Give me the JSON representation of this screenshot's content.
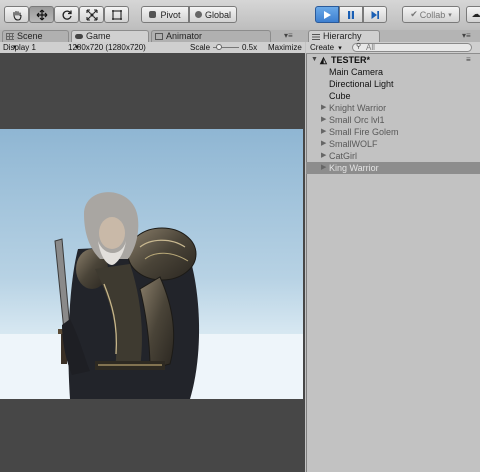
{
  "toolbar": {
    "tools": [
      {
        "name": "hand-tool-icon",
        "active": false
      },
      {
        "name": "move-tool-icon",
        "active": true
      },
      {
        "name": "rotate-tool-icon",
        "active": false
      },
      {
        "name": "scale-tool-icon",
        "active": false
      },
      {
        "name": "rect-tool-icon",
        "active": false
      }
    ],
    "pivot_label": "Pivot",
    "global_label": "Global",
    "collab_label": "Collab",
    "play_icon": "play-icon",
    "pause_icon": "pause-icon",
    "step_icon": "step-icon"
  },
  "tabs": {
    "scene": "Scene",
    "game": "Game",
    "animator": "Animator",
    "hierarchy": "Hierarchy"
  },
  "gamebar": {
    "display": "Display 1",
    "resolution": "1280x720 (1280x720)",
    "scale_label": "Scale",
    "scale_value": "0.5x",
    "maximize": "Maximize"
  },
  "hierarchy": {
    "create_label": "Create",
    "search_placeholder": "All",
    "scene_name": "TESTER*",
    "items": [
      {
        "label": "Main Camera",
        "expandable": false,
        "selected": false
      },
      {
        "label": "Directional Light",
        "expandable": false,
        "selected": false
      },
      {
        "label": "Cube",
        "expandable": false,
        "selected": false
      },
      {
        "label": "Knight Warrior",
        "expandable": true,
        "selected": false
      },
      {
        "label": "Small Orc lvl1",
        "expandable": true,
        "selected": false
      },
      {
        "label": "Small Fire Golem",
        "expandable": true,
        "selected": false
      },
      {
        "label": "SmallWOLF",
        "expandable": true,
        "selected": false
      },
      {
        "label": "CatGirl",
        "expandable": true,
        "selected": false
      },
      {
        "label": "King Warrior",
        "expandable": true,
        "selected": true
      }
    ]
  },
  "colors": {
    "play_blue": "#3d7fd0",
    "selection_grey": "#8d8d8d",
    "sky_top": "#8fb6d3",
    "horizon": "#cfe4ef"
  }
}
